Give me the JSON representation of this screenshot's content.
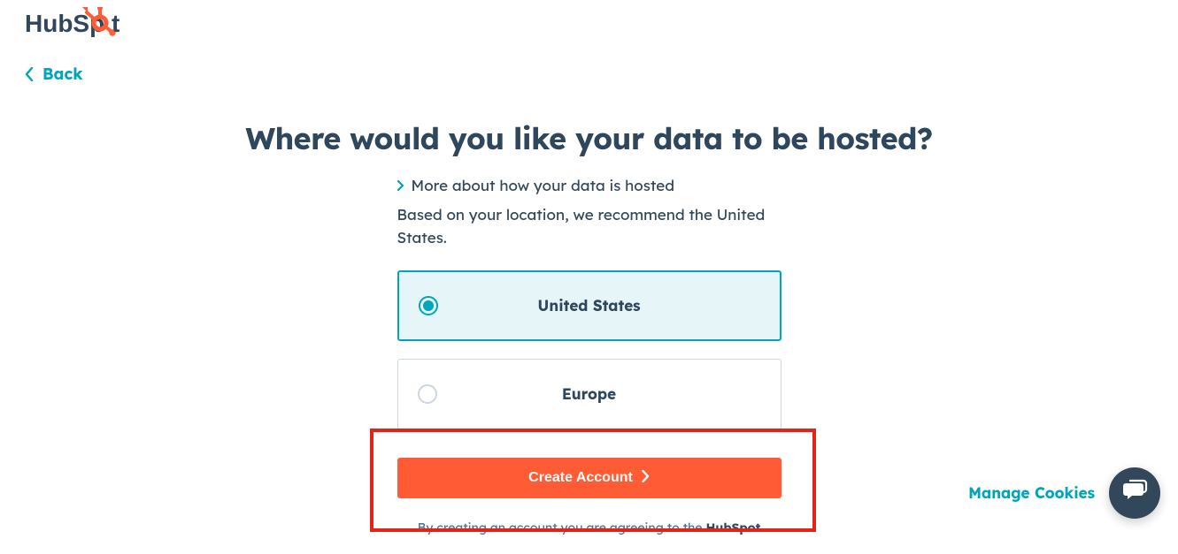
{
  "brand": {
    "name": "HubSpot"
  },
  "nav": {
    "back_label": "Back"
  },
  "heading": "Where would you like your data to be hosted?",
  "more_link": "More about how your data is hosted",
  "recommendation": "Based on your location, we recommend the United States.",
  "options": [
    {
      "label": "United States",
      "selected": true
    },
    {
      "label": "Europe",
      "selected": false
    }
  ],
  "cta": {
    "label": "Create Account"
  },
  "terms": {
    "prefix": "By creating an account you are agreeing to the ",
    "brand": "HubSpot"
  },
  "footer": {
    "manage_cookies": "Manage Cookies"
  }
}
